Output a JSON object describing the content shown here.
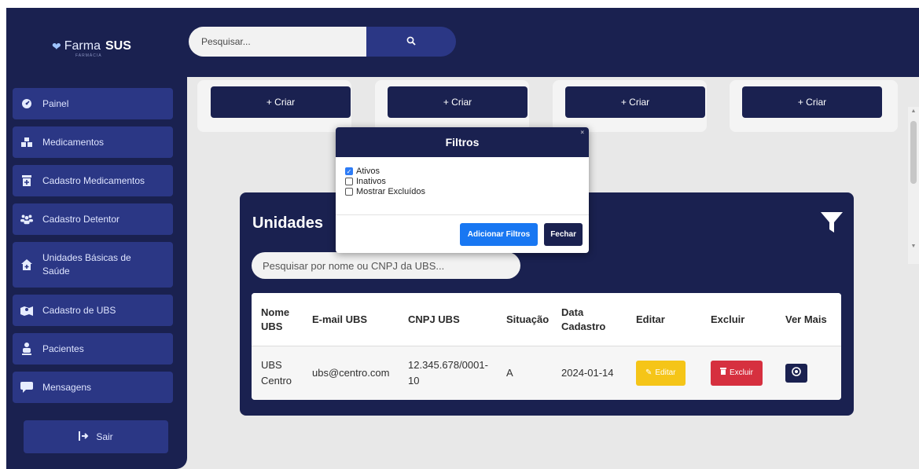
{
  "brand": {
    "name_part1": "Farma",
    "name_part2": "SUS",
    "subtitle": "FARMÁCIA"
  },
  "search": {
    "placeholder": "Pesquisar..."
  },
  "sidebar": {
    "items": [
      {
        "label": "Painel",
        "icon": "dashboard-icon"
      },
      {
        "label": "Medicamentos",
        "icon": "boxes-icon"
      },
      {
        "label": "Cadastro Medicamentos",
        "icon": "medicine-box-icon"
      },
      {
        "label": "Cadastro Detentor",
        "icon": "users-icon"
      },
      {
        "label": "Unidades Básicas de Saúde",
        "icon": "clinic-icon"
      },
      {
        "label": "Cadastro de UBS",
        "icon": "map-user-icon"
      },
      {
        "label": "Pacientes",
        "icon": "patient-icon"
      },
      {
        "label": "Mensagens",
        "icon": "message-icon"
      }
    ],
    "logout_label": "Sair"
  },
  "cards": {
    "create_label": "+ Criar"
  },
  "panel": {
    "title": "Unidades",
    "search_placeholder": "Pesquisar por nome ou CNPJ da UBS...",
    "table": {
      "headers": [
        "Nome UBS",
        "E-mail UBS",
        "CNPJ UBS",
        "Situação",
        "Data Cadastro",
        "Editar",
        "Excluir",
        "Ver Mais"
      ],
      "rows": [
        {
          "nome": "UBS Centro",
          "email": "ubs@centro.com",
          "cnpj": "12.345.678/0001-10",
          "situacao": "A",
          "data": "2024-01-14",
          "edit_label": "Editar",
          "delete_label": "Excluir"
        }
      ]
    }
  },
  "modal": {
    "title": "Filtros",
    "options": [
      {
        "label": "Ativos",
        "checked": true
      },
      {
        "label": "Inativos",
        "checked": false
      },
      {
        "label": "Mostrar Excluídos",
        "checked": false
      }
    ],
    "apply_label": "Adicionar Filtros",
    "close_label": "Fechar"
  },
  "colors": {
    "navy": "#1a2150",
    "sidebar_item": "#2b3785",
    "edit": "#f5c518",
    "delete": "#d6303f",
    "primary": "#1877f2"
  }
}
